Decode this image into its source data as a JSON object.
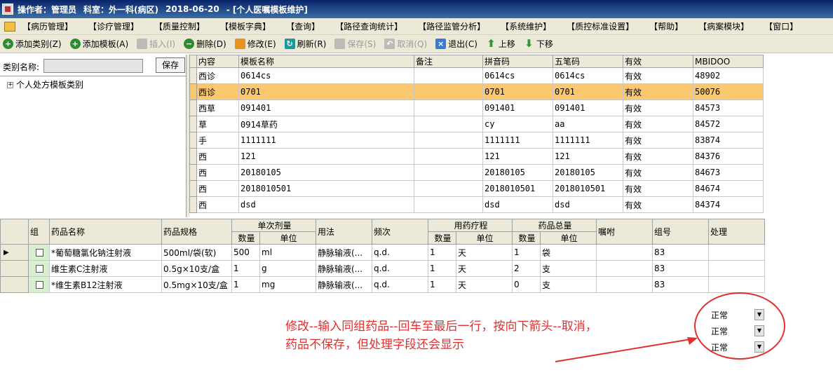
{
  "title": {
    "role": "操作者：管理员",
    "dept": "科室：外一科(病区)",
    "date": "2018-06-20",
    "module": "- [个人医嘱模板维护]"
  },
  "menu": [
    "【病历管理】",
    "【诊疗管理】",
    "【质量控制】",
    "【模板字典】",
    "【查询】",
    "【路径查询统计】",
    "【路径监管分析】",
    "【系统维护】",
    "【质控标准设置】",
    "【帮助】",
    "【病案模块】",
    "【窗口】"
  ],
  "toolbar": {
    "add_category": "添加类别(Z)",
    "add_template": "添加模板(A)",
    "insert": "插入(I)",
    "delete": "删除(D)",
    "modify": "修改(E)",
    "refresh": "刷新(R)",
    "save": "保存(S)",
    "cancel": "取消(Q)",
    "exit": "退出(C)",
    "move_up": "上移",
    "move_down": "下移"
  },
  "left": {
    "category_label": "类别名称:",
    "category_value": "",
    "save_label": "保存",
    "tree_node": "个人处方模板类别"
  },
  "top_grid": {
    "headers": [
      "内容",
      "模板名称",
      "备注",
      "拼音码",
      "五笔码",
      "有效",
      "MBIDOO"
    ],
    "rows": [
      [
        "西诊",
        "0614cs",
        "",
        "0614cs",
        "0614cs",
        "有效",
        "48902"
      ],
      [
        "西诊",
        "0701",
        "",
        "0701",
        "0701",
        "有效",
        "50076"
      ],
      [
        "西草",
        "091401",
        "",
        "091401",
        "091401",
        "有效",
        "84573"
      ],
      [
        "草",
        "0914草药",
        "",
        "cy",
        "aa",
        "有效",
        "84572"
      ],
      [
        "手",
        "1111111",
        "",
        "1111111",
        "1111111",
        "有效",
        "83874"
      ],
      [
        "西",
        "121",
        "",
        "121",
        "121",
        "有效",
        "84376"
      ],
      [
        "西",
        "20180105",
        "",
        "20180105",
        "20180105",
        "有效",
        "84673"
      ],
      [
        "西",
        "2018010501",
        "",
        "2018010501",
        "2018010501",
        "有效",
        "84674"
      ],
      [
        "西",
        "dsd",
        "",
        "dsd",
        "dsd",
        "有效",
        "84374"
      ]
    ]
  },
  "bottom_grid": {
    "headers": {
      "group": "组",
      "drug": "药品名称",
      "spec": "药品规格",
      "unit_dose": "单次剂量",
      "qty": "数量",
      "unit": "单位",
      "usage": "用法",
      "freq": "频次",
      "course": "用药疗程",
      "course_qty": "数量",
      "course_unit": "单位",
      "total": "药品总量",
      "total_qty": "数量",
      "total_unit": "单位",
      "advice": "嘱咐",
      "group_no": "组号",
      "process": "处理"
    },
    "rows": [
      {
        "drug": "*葡萄糖氯化钠注射液",
        "spec": "500ml/袋(软)",
        "dose_qty": "500",
        "dose_unit": "ml",
        "usage": "静脉输液(...",
        "freq": "q.d.",
        "course_qty": "1",
        "course_unit": "天",
        "total_qty": "1",
        "total_unit": "袋",
        "advice": "",
        "group_no": "83",
        "process": ""
      },
      {
        "drug": "维生素C注射液",
        "spec": "0.5g×10支/盒",
        "dose_qty": "1",
        "dose_unit": "g",
        "usage": "静脉输液(...",
        "freq": "q.d.",
        "course_qty": "1",
        "course_unit": "天",
        "total_qty": "2",
        "total_unit": "支",
        "advice": "",
        "group_no": "83",
        "process": ""
      },
      {
        "drug": "*维生素B12注射液",
        "spec": "0.5mg×10支/盒",
        "dose_qty": "1",
        "dose_unit": "mg",
        "usage": "静脉输液(...",
        "freq": "q.d.",
        "course_qty": "1",
        "course_unit": "天",
        "total_qty": "0",
        "total_unit": "支",
        "advice": "",
        "group_no": "83",
        "process": ""
      }
    ]
  },
  "annotation": {
    "line1": "修改--输入同组药品--回车至最后一行，按向下箭头--取消，",
    "line2": "药品不保存，但处理字段还会显示",
    "color": "#e03030"
  },
  "dropdowns": [
    "正常",
    "正常",
    "正常"
  ]
}
